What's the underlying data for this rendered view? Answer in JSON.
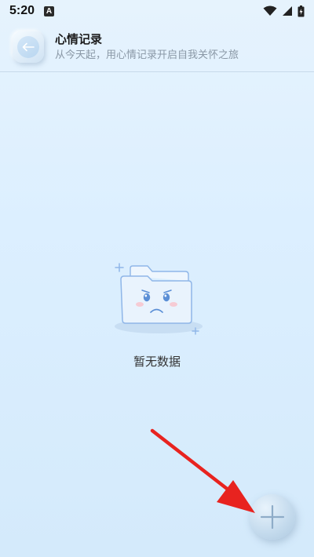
{
  "status_bar": {
    "time": "5:20",
    "notification_icon": "A"
  },
  "header": {
    "back_icon": "arrow-left-icon",
    "title": "心情记录",
    "subtitle": "从今天起，用心情记录开启自我关怀之旅"
  },
  "empty_state": {
    "message": "暂无数据",
    "illustration": "sad-folder-icon"
  },
  "fab": {
    "icon": "plus-icon"
  },
  "annotation": {
    "icon": "red-arrow-icon",
    "color": "#e8231f"
  },
  "colors": {
    "background": "#dcefff",
    "accent": "#8fb6e8"
  }
}
